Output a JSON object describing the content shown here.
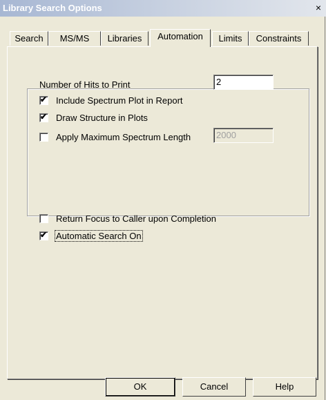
{
  "window": {
    "title": "Library Search Options",
    "close_symbol": "×"
  },
  "tabs": [
    {
      "label": "Search",
      "active": false
    },
    {
      "label": "MS/MS",
      "active": false
    },
    {
      "label": "Libraries",
      "active": false
    },
    {
      "label": "Automation",
      "active": true
    },
    {
      "label": "Limits",
      "active": false
    },
    {
      "label": "Constraints",
      "active": false
    }
  ],
  "automation": {
    "hits_label": "Number of Hits to Print",
    "hits_value": "2",
    "include_plot": {
      "label": "Include Spectrum Plot in Report",
      "checked": true
    },
    "draw_structure": {
      "label": "Draw Structure in Plots",
      "checked": true
    },
    "apply_max_length": {
      "label": "Apply Maximum Spectrum Length",
      "checked": false,
      "value": "2000"
    },
    "return_focus": {
      "label": "Return Focus to Caller upon Completion",
      "checked": false
    },
    "automatic_search": {
      "label": "Automatic Search On",
      "checked": true
    }
  },
  "buttons": {
    "ok": "OK",
    "cancel": "Cancel",
    "help": "Help"
  },
  "check_mark": "✔",
  "icons": {
    "close": "close-icon",
    "checkbox-checked": "checkmark-icon"
  }
}
